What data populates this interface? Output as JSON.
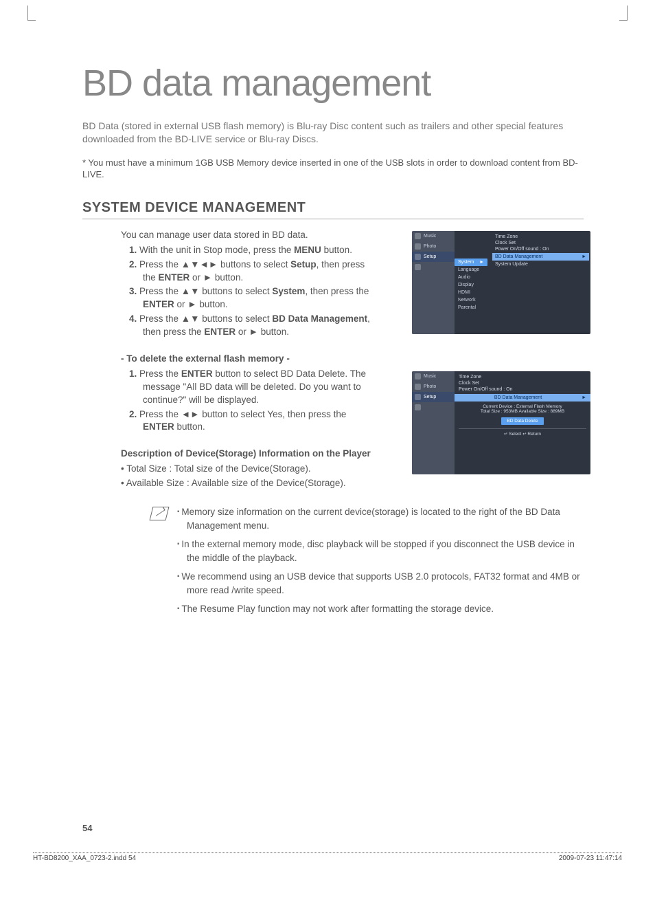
{
  "page": {
    "title": "BD data management",
    "intro": "BD Data (stored in external USB flash memory) is Blu-ray Disc content such as trailers and other special features downloaded from the BD-LIVE service or Blu-ray Discs.",
    "footnote": "* You must have a minimum 1GB USB Memory device inserted in one of the USB slots in order to download content from BD-LIVE.",
    "section_heading": "SYSTEM DEVICE MANAGEMENT",
    "lead": "You can manage user data stored in BD data.",
    "steps": [
      {
        "n": "1.",
        "pre": "With the unit in Stop mode, press the ",
        "b": "MENU",
        "post": " button."
      },
      {
        "n": "2.",
        "pre": "Press the ▲▼◄► buttons to select ",
        "b": "Setup",
        "post": ", then press the ENTER or ► button."
      },
      {
        "n": "3.",
        "pre": "Press the ▲▼ buttons to select ",
        "b": "System",
        "post": ", then press the ENTER or ► button."
      },
      {
        "n": "4.",
        "pre": "Press the ▲▼ buttons to select ",
        "b": "BD Data Management",
        "post": ", then press the  ENTER or ► button."
      }
    ],
    "delete_heading": "- To delete the external flash memory -",
    "delete_steps": [
      {
        "n": "1.",
        "text": "Press the ENTER button to select BD Data Delete. The message \"All BD data will be deleted. Do you want to continue?\" will be displayed."
      },
      {
        "n": "2.",
        "text": "Press the ◄► button to select Yes, then press the ENTER button."
      }
    ],
    "desc_heading": "Description of Device(Storage) Information on the Player",
    "desc_bullets": [
      "Total Size : Total size of the Device(Storage).",
      "Available Size : Available size of the Device(Storage)."
    ],
    "notes": [
      "Memory size information on the current device(storage) is located to the right of the BD Data Management menu.",
      "In the external memory mode, disc playback will be stopped if you disconnect the USB device in the middle of the playback.",
      "We recommend using an USB device that supports USB 2.0 protocols, FAT32 format and 4MB or more read /write speed.",
      "The Resume Play function may not work after formatting the storage device."
    ],
    "page_number": "54",
    "footer_left": "HT-BD8200_XAA_0723-2.indd   54",
    "footer_right": "2009-07-23     11:47:14"
  },
  "screen1": {
    "sidebar": [
      "Music",
      "Photo",
      "Setup"
    ],
    "mid": [
      "System",
      "Language",
      "Audio",
      "Display",
      "HDMI",
      "Network",
      "Parental"
    ],
    "right_top": [
      "Time Zone",
      "Clock Set",
      "Power On/Off sound :   On"
    ],
    "right_hl": "BD Data Management",
    "right_after": "System Update"
  },
  "screen2": {
    "sidebar": [
      "Music",
      "Photo",
      "Setup"
    ],
    "right_top": [
      "Time Zone",
      "Clock Set",
      "Power On/Off sound :   On"
    ],
    "hl": "BD Data Management",
    "sub1": "Current Device : External Flash Memory",
    "sub2": "Total Size : 953MB       Available Size : 889MB",
    "btn": "BD Data Delete",
    "foot": "↵ Select        ↩ Return"
  }
}
